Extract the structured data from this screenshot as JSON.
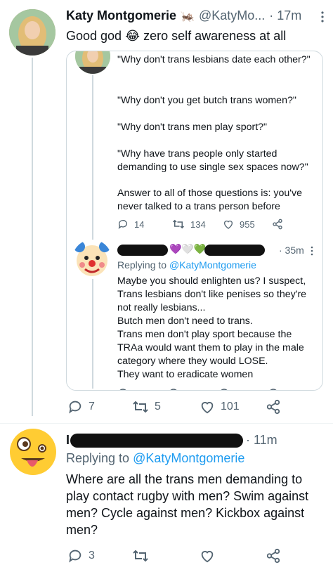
{
  "tweet1": {
    "name": "Katy Montgomerie",
    "handle": "@KatyMo...",
    "time": "· 17m",
    "text": "Good god 😂 zero self awareness at all",
    "stats": {
      "replies": "7",
      "retweets": "5",
      "likes": "101"
    }
  },
  "quote1": {
    "lines": [
      "\"Why don't trans lesbians date each other?\"",
      "\"Why don't you get butch trans women?\"",
      "\"Why don't trans men play sport?\"",
      "\"Why have trans people only started demanding to use single sex spaces now?\"",
      "Answer to all of those questions is: you've never talked to a trans person before"
    ],
    "stats": {
      "replies": "14",
      "retweets": "134",
      "likes": "955"
    }
  },
  "quote2": {
    "hearts": "💜🤍💚",
    "time": "· 35m",
    "replying_prefix": "Replying to ",
    "replying_handle": "@KatyMontgomerie",
    "text": "Maybe you should enlighten us? I suspect,\nTrans lesbians don't like penises so they're not really lesbians...\nButch men don't need to trans.\nTrans men don't play sport because the TRAa would want them to play in the male category where they would LOSE.\nThey want to eradicate women"
  },
  "tweet2": {
    "name_initial": "I",
    "time": "· 11m",
    "replying_prefix": "Replying to ",
    "replying_handle": "@KatyMontgomerie",
    "text": "Where are all the trans men demanding to play contact rugby with men? Swim against men? Cycle against men? Kickbox against men?",
    "stats": {
      "replies": "3"
    }
  },
  "colors": {
    "link": "#1d9bf0",
    "muted": "#536471",
    "border": "#cfd9de"
  }
}
